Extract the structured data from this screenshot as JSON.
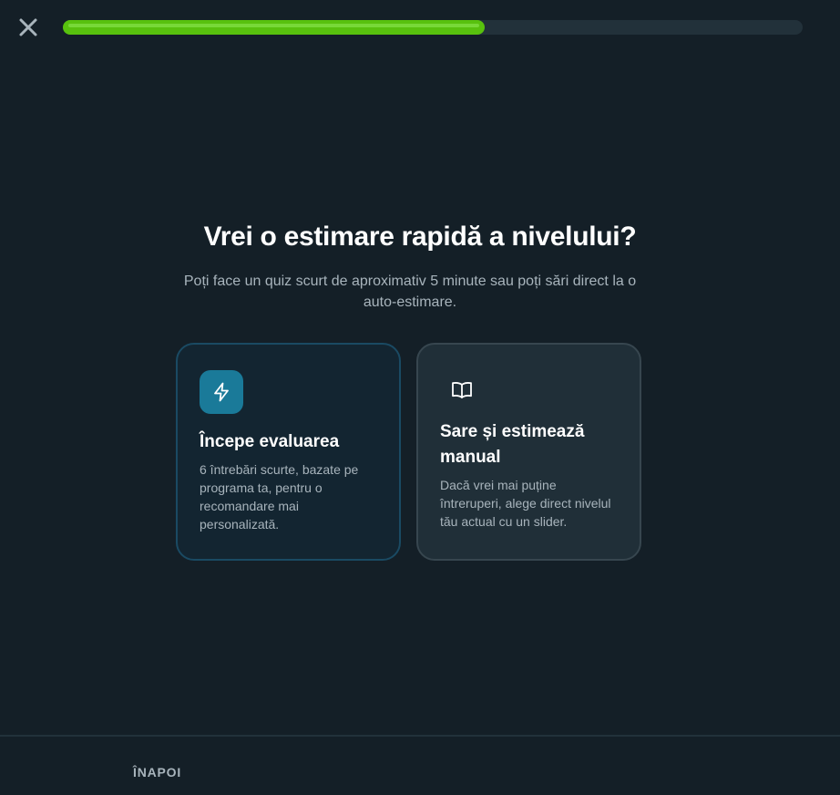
{
  "header": {
    "close_icon": "close-icon",
    "progress_percent": 57
  },
  "main": {
    "title": "Vrei o estimare rapidă a nivelului?",
    "subtitle": "Poți face un quiz scurt de aproximativ 5 minute sau poți sări direct la o auto-estimare."
  },
  "options": [
    {
      "icon": "lightning-icon",
      "title": "Începe evaluarea",
      "description": "6 întrebări scurte, bazate pe programa ta, pentru o recomandare mai personalizată."
    },
    {
      "icon": "book-icon",
      "title": "Sare și estimează manual",
      "description": "Dacă vrei mai puține întreruperi, alege direct nivelul tău actual cu un slider."
    }
  ],
  "footer": {
    "back_label": "ÎNAPOI"
  },
  "colors": {
    "background": "#141f27",
    "progress": "#58c10e",
    "accent": "#1a7a99",
    "muted_text": "#a8b4bc"
  }
}
